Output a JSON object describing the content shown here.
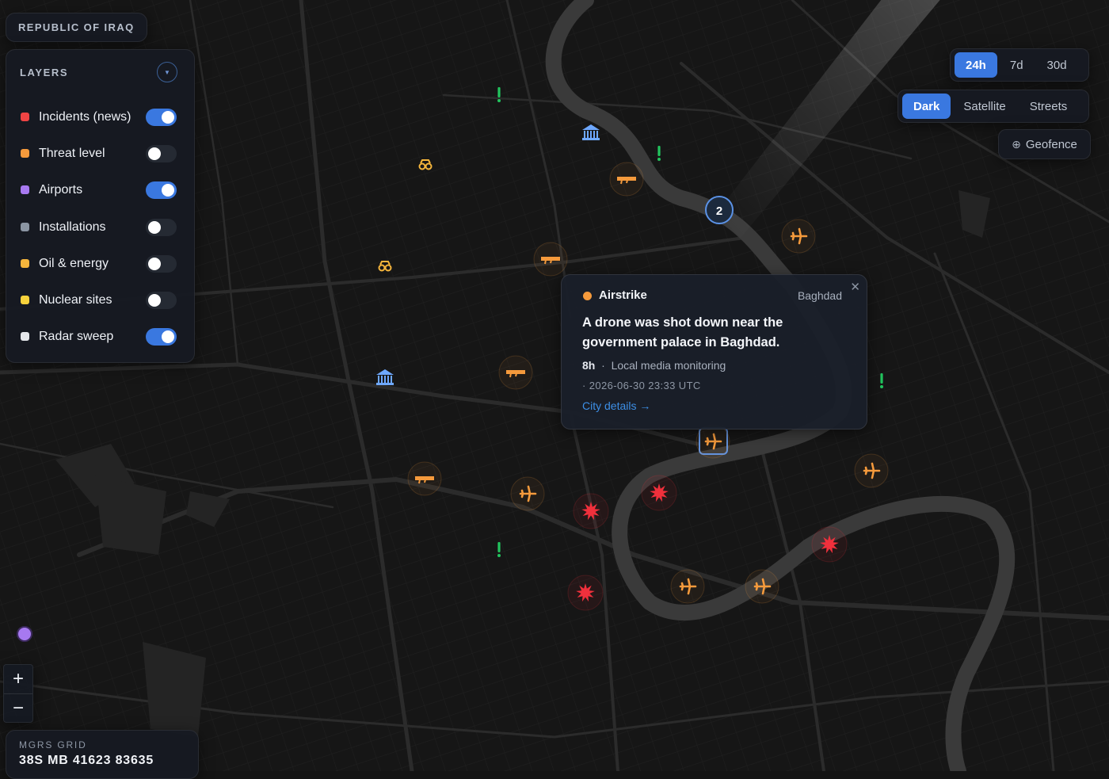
{
  "country": {
    "label": "REPUBLIC OF IRAQ"
  },
  "layers": {
    "title": "LAYERS",
    "items": [
      {
        "label": "Incidents (news)",
        "color": "#ef4444",
        "enabled": true
      },
      {
        "label": "Threat level",
        "color": "#f59a3c",
        "enabled": false
      },
      {
        "label": "Airports",
        "color": "#a779f0",
        "enabled": true
      },
      {
        "label": "Installations",
        "color": "#8b95a3",
        "enabled": false
      },
      {
        "label": "Oil & energy",
        "color": "#f5b53c",
        "enabled": false
      },
      {
        "label": "Nuclear sites",
        "color": "#f7d23c",
        "enabled": false
      },
      {
        "label": "Radar sweep",
        "color": "#e6e8ec",
        "enabled": true
      }
    ]
  },
  "time_range": {
    "options": [
      "24h",
      "7d",
      "30d"
    ],
    "selected": "24h"
  },
  "basemap": {
    "options": [
      "Dark",
      "Satellite",
      "Streets"
    ],
    "selected": "Dark"
  },
  "geofence": {
    "label": "Geofence"
  },
  "popup": {
    "type": "Airstrike",
    "city": "Baghdad",
    "title": "A drone was shot down near the government palace in Baghdad.",
    "age": "8h",
    "source": "Local media monitoring",
    "timestamp": "· 2026-06-30 23:33 UTC",
    "link": "City details →"
  },
  "cluster": {
    "count": "2"
  },
  "zoom": {
    "in": "+",
    "out": "−"
  },
  "mgrs": {
    "label": "MGRS GRID",
    "value": "38S MB 41623 83635"
  },
  "colors": {
    "accent": "#3a78e0",
    "airstrike": "#f59a3c",
    "explosion": "#f0303c",
    "alert": "#22c55e",
    "landmark": "#6ea8ff",
    "oil": "#f5b53c"
  },
  "markers": [
    {
      "type": "alert-icon"
    },
    {
      "type": "alert-icon"
    },
    {
      "type": "alert-icon"
    },
    {
      "type": "alert-icon"
    },
    {
      "type": "landmark-icon"
    },
    {
      "type": "landmark-icon"
    },
    {
      "type": "oil-icon"
    },
    {
      "type": "oil-icon"
    },
    {
      "type": "weapon-icon"
    },
    {
      "type": "weapon-icon"
    },
    {
      "type": "weapon-icon"
    },
    {
      "type": "weapon-icon"
    },
    {
      "type": "airstrike-plane-icon"
    },
    {
      "type": "airstrike-plane-icon"
    },
    {
      "type": "airstrike-plane-icon"
    },
    {
      "type": "airstrike-plane-icon"
    },
    {
      "type": "airstrike-plane-icon"
    },
    {
      "type": "airstrike-plane-icon"
    },
    {
      "type": "explosion-icon"
    },
    {
      "type": "explosion-icon"
    },
    {
      "type": "explosion-icon"
    },
    {
      "type": "explosion-icon"
    }
  ]
}
